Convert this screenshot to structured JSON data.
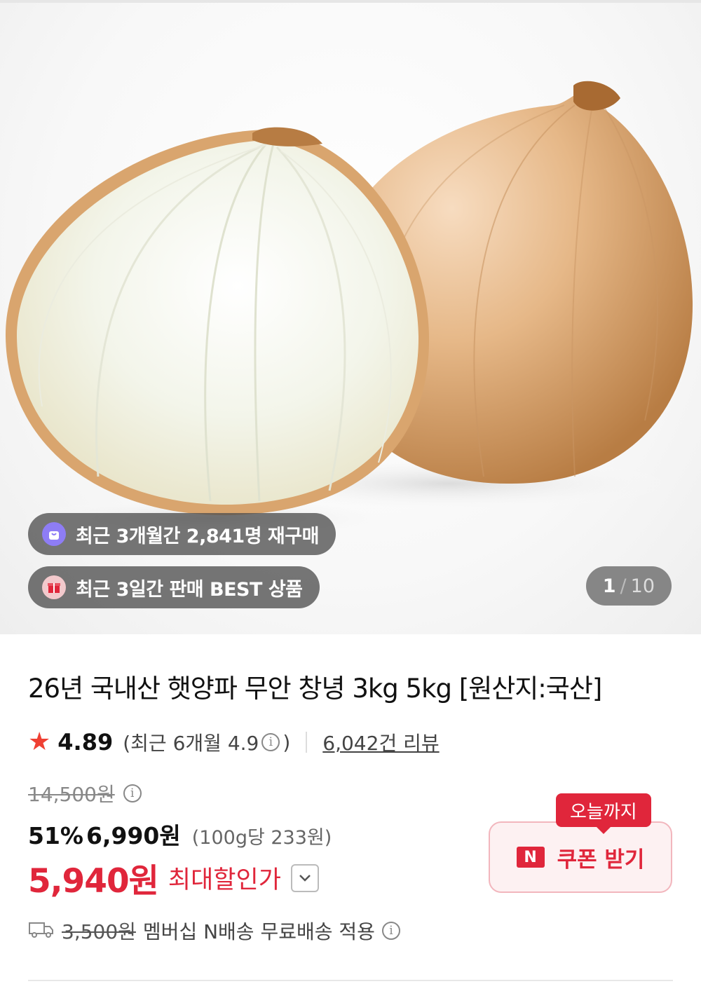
{
  "hero": {
    "badges": [
      {
        "icon": "shopping-bag-icon",
        "text": "최근 3개월간 2,841명 재구매"
      },
      {
        "icon": "gift-box-icon",
        "text": "최근 3일간 판매 BEST 상품"
      }
    ],
    "counter": {
      "current": "1",
      "separator": "/",
      "total": "10"
    }
  },
  "product": {
    "title": "26년 국내산 햇양파 무안 창녕 3kg 5kg [원산지:국산]",
    "rating": {
      "score": "4.89",
      "recent_open": "(최근 6개월 4.9",
      "recent_close": ")",
      "reviews": "6,042건 리뷰"
    },
    "price": {
      "original": "14,500원",
      "discount_rate": "51%",
      "sale": "6,990원",
      "unit_price": "(100g당 233원)",
      "final": "5,940원",
      "final_label": "최대할인가"
    },
    "coupon": {
      "tag": "오늘까지",
      "icon_letter": "N",
      "label": "쿠폰 받기"
    },
    "shipping": {
      "original_fee": "3,500원",
      "text": "멤버십 N배송 무료배송 적용"
    }
  },
  "colors": {
    "accent_red": "#e0263b",
    "star": "#ef4033",
    "badge_purple": "#8e7df5"
  }
}
